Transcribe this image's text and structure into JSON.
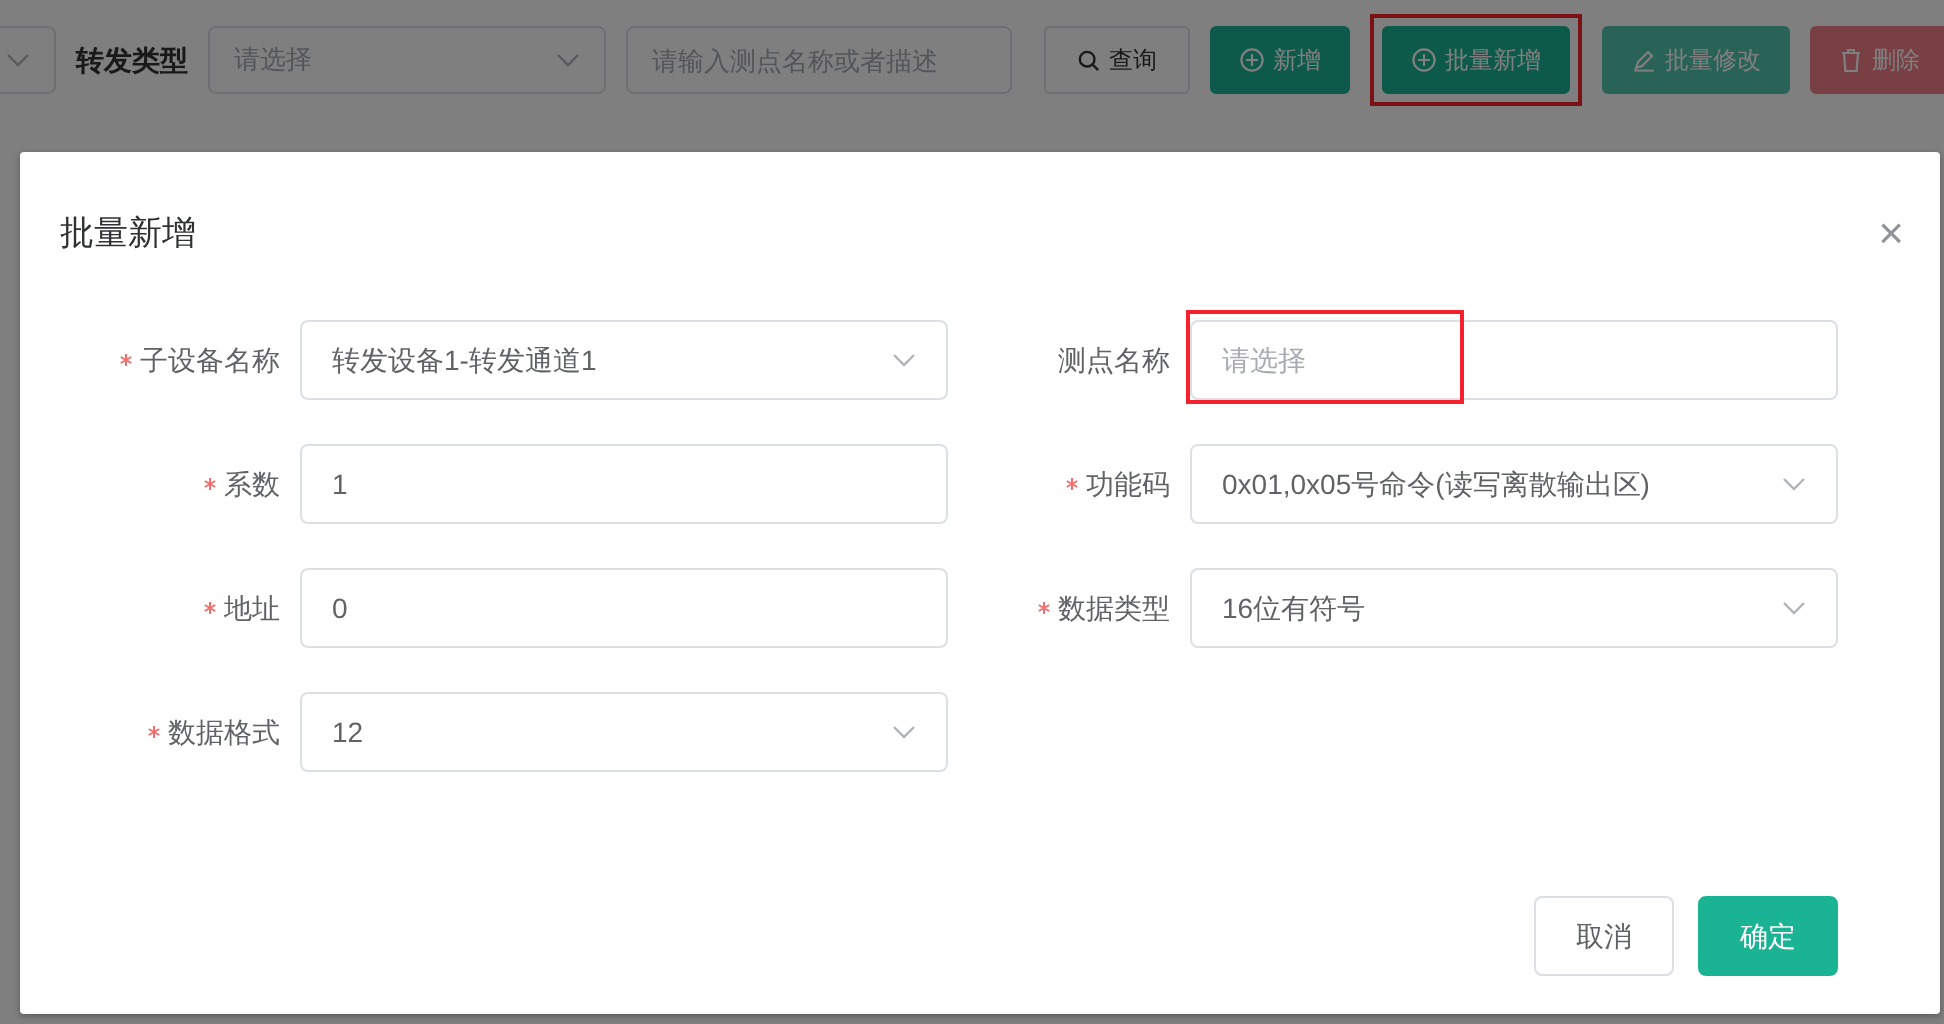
{
  "toolbar": {
    "items": [
      {
        "kind": "select"
      },
      {
        "kind": "label",
        "text": "转发类型"
      },
      {
        "kind": "select",
        "placeholder": "请选择"
      },
      {
        "kind": "input",
        "placeholder": "请输入测点名称或者描述"
      },
      {
        "kind": "query",
        "text": "查询",
        "disabled": false,
        "highlight": false
      },
      {
        "kind": "add",
        "text": "新增",
        "disabled": false,
        "highlight": false
      },
      {
        "kind": "add",
        "text": "批量新增",
        "disabled": false,
        "highlight": true
      },
      {
        "kind": "edit",
        "text": "批量修改",
        "disabled": true,
        "highlight": false
      },
      {
        "kind": "delete",
        "text": "删除",
        "disabled": true,
        "highlight": false
      }
    ]
  },
  "dialog": {
    "title": "批量新增",
    "close": "×",
    "fields": [
      {
        "label": "子设备名称",
        "required": true,
        "kind": "select",
        "value": "转发设备1-转发通道1",
        "highlight": false
      },
      {
        "label": "测点名称",
        "required": false,
        "kind": "input",
        "placeholder": "请选择",
        "highlight": true
      },
      {
        "label": "系数",
        "required": true,
        "kind": "input",
        "value": "1",
        "highlight": false
      },
      {
        "label": "功能码",
        "required": true,
        "kind": "select",
        "value": "0x01,0x05号命令(读写离散输出区)",
        "highlight": false
      },
      {
        "label": "地址",
        "required": true,
        "kind": "input",
        "value": "0",
        "highlight": false
      },
      {
        "label": "数据类型",
        "required": true,
        "kind": "select",
        "value": "16位有符号",
        "highlight": false
      },
      {
        "label": "数据格式",
        "required": true,
        "kind": "select",
        "value": "12",
        "highlight": false
      }
    ],
    "buttons": [
      {
        "kind": "cancel",
        "text": "取消"
      },
      {
        "kind": "confirm",
        "text": "确定"
      }
    ]
  }
}
